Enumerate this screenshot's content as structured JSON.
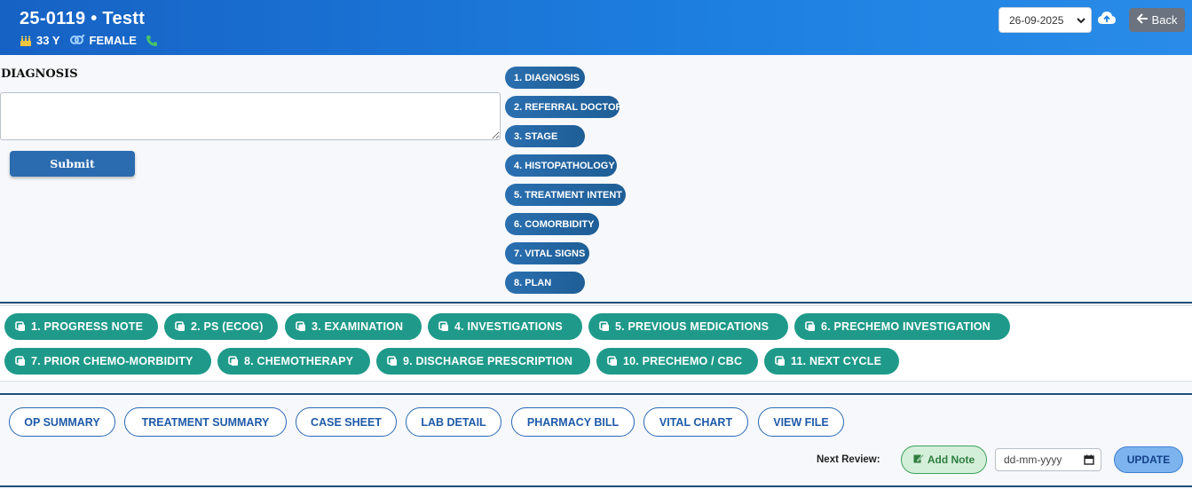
{
  "header": {
    "patient_title": "25-0119  •  Testt",
    "age": "33 Y",
    "gender": "FEMALE",
    "date_selected": "26-09-2025",
    "back_label": "Back"
  },
  "diagnosis": {
    "label": "DIAGNOSIS",
    "value": "",
    "submit_label": "Submit"
  },
  "sections": [
    "1. DIAGNOSIS",
    "2. REFERRAL DOCTOR",
    "3. STAGE",
    "4. HISTOPATHOLOGY",
    "5. TREATMENT INTENT",
    "6. COMORBIDITY",
    "7. VITAL SIGNS",
    "8. PLAN"
  ],
  "tools": [
    "1. PROGRESS NOTE",
    "2. PS (ECOG)",
    "3. EXAMINATION",
    "4. INVESTIGATIONS",
    "5. PREVIOUS MEDICATIONS",
    "6. PRECHEMO INVESTIGATION",
    "7. PRIOR CHEMO-MORBIDITY",
    "8. CHEMOTHERAPY",
    "9. DISCHARGE PRESCRIPTION",
    "10. PRECHEMO / CBC",
    "11. NEXT CYCLE"
  ],
  "actions": [
    "OP SUMMARY",
    "TREATMENT SUMMARY",
    "CASE SHEET",
    "LAB DETAIL",
    "PHARMACY BILL",
    "VITAL CHART",
    "VIEW FILE"
  ],
  "review": {
    "label": "Next Review:",
    "add_note_label": "Add Note",
    "date_placeholder": "dd-mm-yyyy",
    "update_label": "UPDATE"
  },
  "colors": {
    "header": "#1d7fe0",
    "section_pill": "#2a6fb0",
    "tool_button": "#1f9a8a",
    "outline_button": "#2a68b5"
  }
}
